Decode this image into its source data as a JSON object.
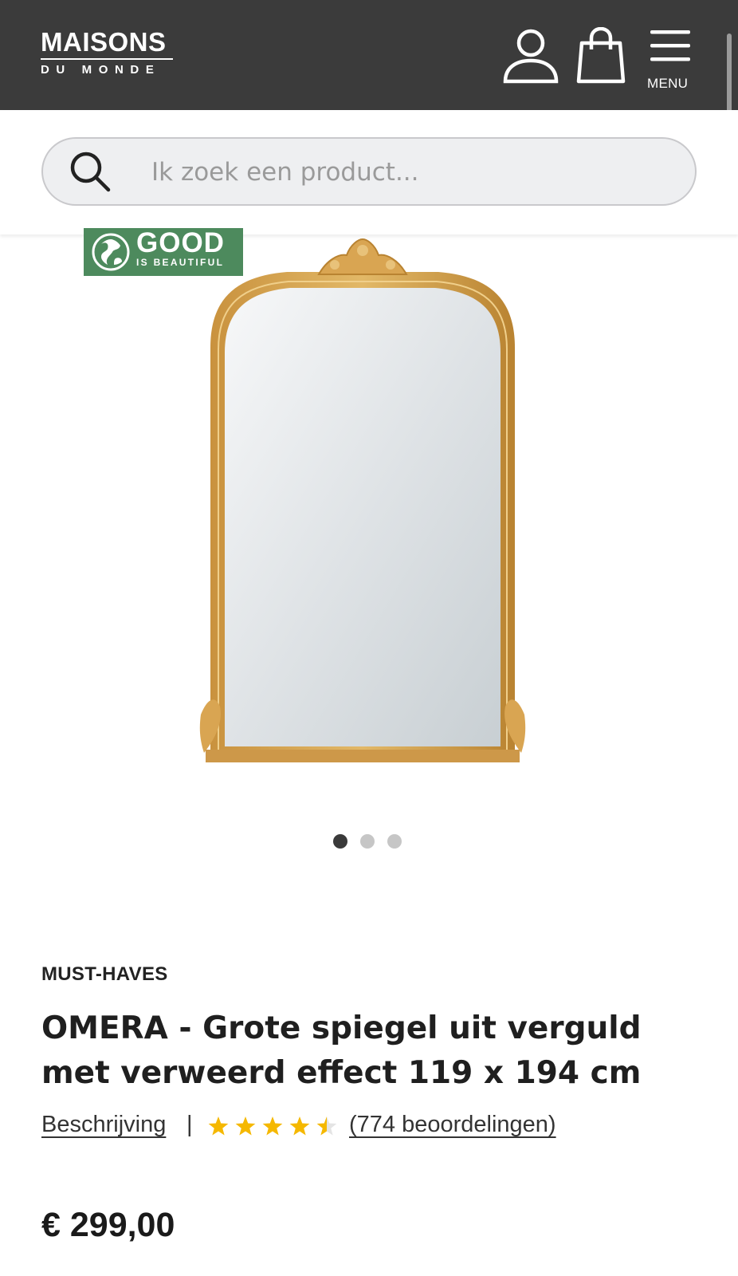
{
  "header": {
    "logo_top": "MAISONS",
    "logo_bottom": "DU MONDE",
    "menu_label": "MENU",
    "background": "#3b3b3b"
  },
  "search": {
    "placeholder": "Ik zoek een product..."
  },
  "gallery": {
    "badge_title": "GOOD",
    "badge_subtitle": "IS BEAUTIFUL",
    "badge_color": "#4d8a5d",
    "slide_count": 3,
    "active_slide": 1
  },
  "product": {
    "collection": "MUST-HAVES",
    "title": "OMERA - Grote spiegel uit verguld met verweerd effect 119 x 194 cm",
    "description_link": "Beschrijving",
    "separator": "|",
    "rating": 4.5,
    "rating_max": 5,
    "star_color": "#f5b800",
    "reviews_link": "(774 beoordelingen)",
    "price": "€ 299,00"
  }
}
